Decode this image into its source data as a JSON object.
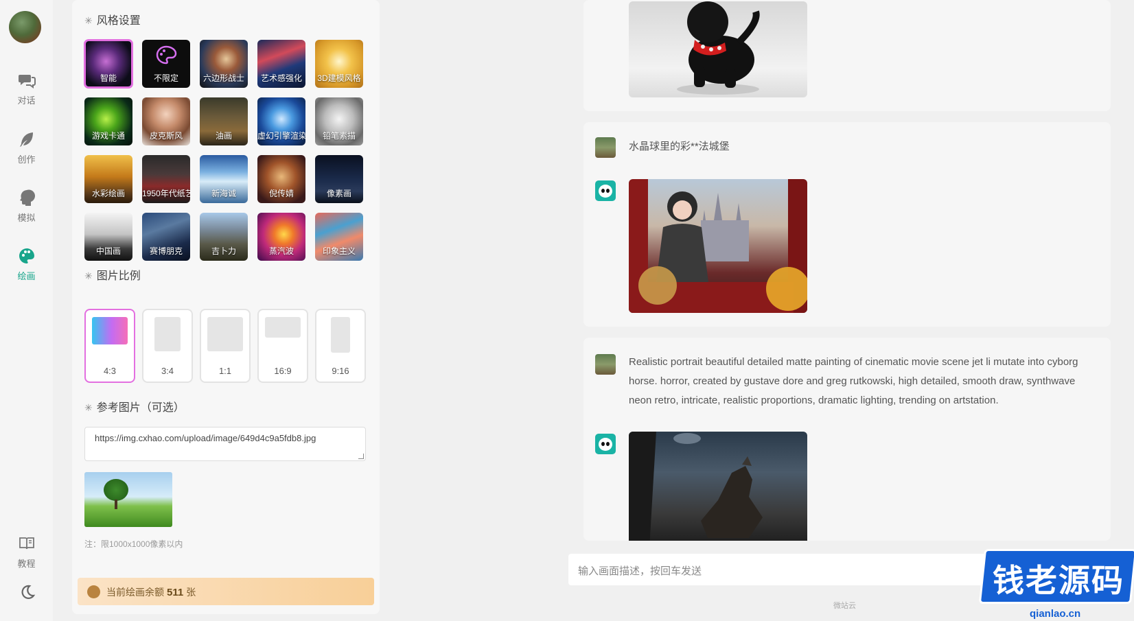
{
  "nav": {
    "items": [
      {
        "label": "对话",
        "icon": "chat-icon"
      },
      {
        "label": "创作",
        "icon": "feather-icon"
      },
      {
        "label": "模拟",
        "icon": "head-icon"
      },
      {
        "label": "绘画",
        "icon": "palette-icon"
      }
    ],
    "tutorial_label": "教程",
    "theme_icon": "moon-icon"
  },
  "panel": {
    "style_title": "风格设置",
    "styles": [
      {
        "label": "智能"
      },
      {
        "label": "不限定"
      },
      {
        "label": "六边形战士"
      },
      {
        "label": "艺术感强化"
      },
      {
        "label": "3D建模风格"
      },
      {
        "label": "游戏卡通"
      },
      {
        "label": "皮克斯风"
      },
      {
        "label": "油画"
      },
      {
        "label": "虚幻引擎渲染"
      },
      {
        "label": "铅笔素描"
      },
      {
        "label": "水彩绘画"
      },
      {
        "label": "1950年代纸艺"
      },
      {
        "label": "新海诚"
      },
      {
        "label": "倪传婧"
      },
      {
        "label": "像素画"
      },
      {
        "label": "中国画"
      },
      {
        "label": "赛博朋克"
      },
      {
        "label": "吉卜力"
      },
      {
        "label": "蒸汽波"
      },
      {
        "label": "印象主义"
      }
    ],
    "selected_style": "智能",
    "ratio_title": "图片比例",
    "ratios": [
      {
        "label": "4:3"
      },
      {
        "label": "3:4"
      },
      {
        "label": "1:1"
      },
      {
        "label": "16:9"
      },
      {
        "label": "9:16"
      }
    ],
    "selected_ratio": "4:3",
    "ref_title": "参考图片（可选）",
    "ref_url": "https://img.cxhao.com/upload/image/649d4c9a5fdb8.jpg",
    "ref_note": "注：限1000x1000像素以内",
    "quota_prefix": "当前绘画余额",
    "quota_value": "511",
    "quota_unit": "张"
  },
  "chat": {
    "messages": [
      {
        "prompt": "水晶球里的彩**法城堡"
      },
      {
        "prompt": "Realistic portrait beautiful detailed matte painting of cinematic movie scene jet li mutate into cyborg horse. horror, created by gustave dore and greg rutkowski, high detailed, smooth draw, synthwave neon retro, intricate, realistic proportions, dramatic lighting, trending on artstation."
      }
    ],
    "input_placeholder": "输入画面描述，按回车发送",
    "footer": "微站云"
  },
  "watermark": {
    "text": "钱老源码",
    "domain": "qianlao.cn"
  },
  "colors": {
    "accent": "#18a58b",
    "selected_border": "#e36fe0",
    "watermark": "#1560d4"
  }
}
